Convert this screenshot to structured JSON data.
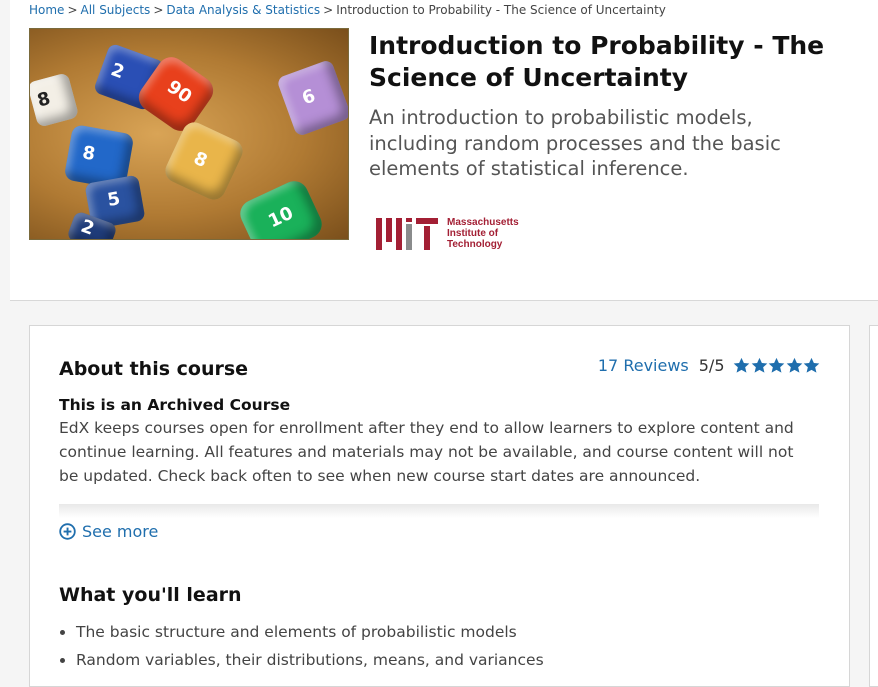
{
  "breadcrumb": {
    "items": [
      "Home",
      "All Subjects",
      "Data Analysis & Statistics"
    ],
    "current": "Introduction to Probability - The Science of Uncertainty",
    "separator": ">"
  },
  "course": {
    "title": "Introduction to Probability - The Science of Uncertainty",
    "subtitle": "An introduction to probabilistic models, including random processes and the basic elements of statistical inference.",
    "hero_icon": "dice-image"
  },
  "institution": {
    "logo_icon": "mit-logo",
    "name_lines": [
      "Massachusetts",
      "Institute of",
      "Technology"
    ]
  },
  "about": {
    "heading": "About this course",
    "reviews_link": "17 Reviews",
    "rating_text": "5/5",
    "stars": 5,
    "archived_heading": "This is an Archived Course",
    "archived_text": "EdX keeps courses open for enrollment after they end to allow learners to explore content and continue learning. All features and materials may not be available, and course content will not be updated. Check back often to see when new course start dates are announced.",
    "see_more": "See more"
  },
  "learn": {
    "heading": "What you'll learn",
    "items": [
      "The basic structure and elements of probabilistic models",
      "Random variables, their distributions, means, and variances"
    ]
  },
  "colors": {
    "link": "#1f6ead",
    "mit_red": "#a31f34",
    "star": "#1f6ead"
  }
}
